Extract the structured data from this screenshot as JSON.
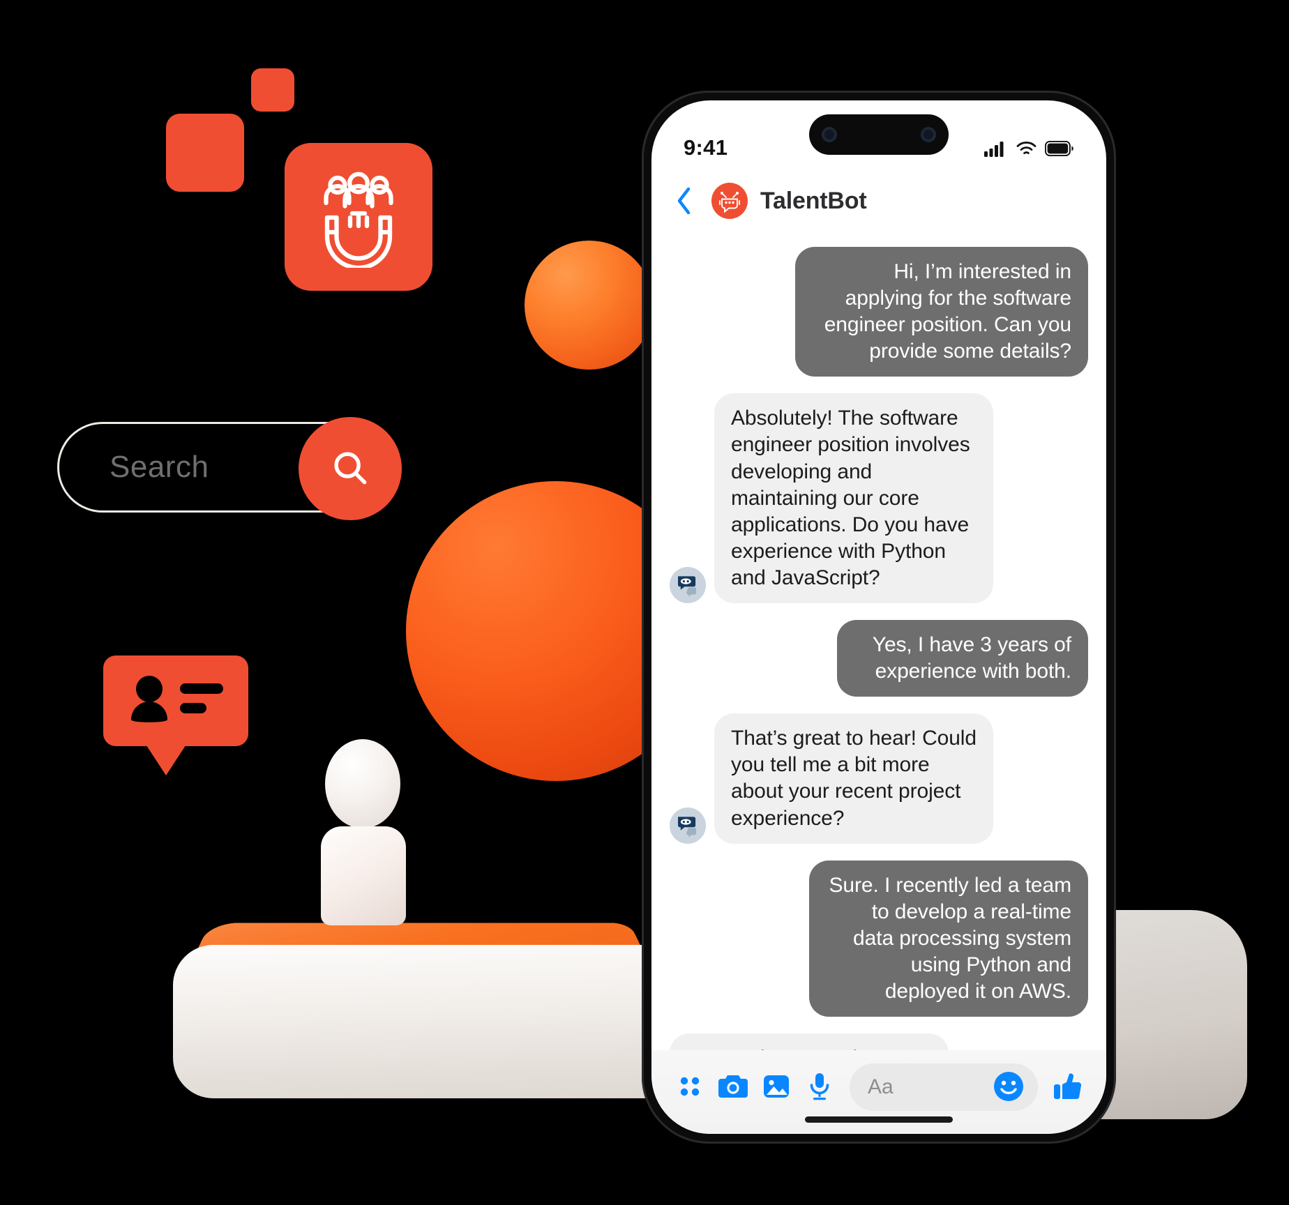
{
  "scene": {
    "brand_orange": "#f04e32",
    "accent_blue": "#0a87ff",
    "bubble_out_bg": "#6e6e6e",
    "bubble_in_bg": "#f0f0f0",
    "background": "#000000"
  },
  "decor": {
    "square_large": "square-large",
    "square_small": "square-small",
    "magnet_tile_icon": "talent-magnet-icon",
    "profile_card_icon": "profile-card-icon",
    "sphere_small": "sphere-small",
    "sphere_large": "sphere-large",
    "figure": "person-figurine",
    "pedestal": "pedestal-platform"
  },
  "search": {
    "placeholder": "Search",
    "value": "Search",
    "button_icon": "search-icon"
  },
  "phone": {
    "status_bar": {
      "time": "9:41",
      "icons": [
        "cellular-signal-icon",
        "wifi-icon",
        "battery-icon"
      ]
    },
    "header": {
      "back_icon": "chevron-left-icon",
      "avatar_icon": "talentbot-avatar-icon",
      "title": "TalentBot"
    },
    "messages": [
      {
        "sender": "user",
        "text": "Hi, I’m interested in applying for the software engineer position. Can you provide some details?",
        "avatar": null
      },
      {
        "sender": "bot",
        "text": "Absolutely! The software engineer position involves developing and maintaining our core applications. Do you have experience with Python and JavaScript?",
        "avatar": "bot-avatar-icon"
      },
      {
        "sender": "user",
        "text": "Yes, I have 3 years of experience with both.",
        "avatar": null
      },
      {
        "sender": "bot",
        "text": "That’s great to hear! Could you tell me a bit more about your recent project experience?",
        "avatar": "bot-avatar-icon"
      },
      {
        "sender": "user",
        "text": "Sure. I recently led a team to develop a real-time data processing system using Python and deployed it on AWS.",
        "avatar": null
      },
      {
        "sender": "bot",
        "text": "Impressive! Based on your experience, you seem like a",
        "avatar": null
      }
    ],
    "toolbar": {
      "apps_label": "apps-grid-icon",
      "camera_label": "camera-icon",
      "gallery_label": "photo-icon",
      "mic_label": "microphone-icon",
      "input_placeholder": "Aa",
      "emoji_label": "smiley-icon",
      "like_label": "thumbs-up-icon"
    }
  }
}
